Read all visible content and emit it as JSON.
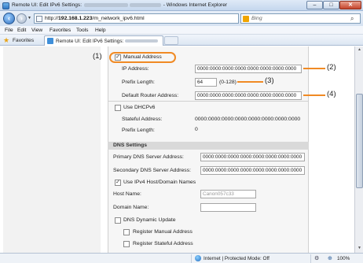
{
  "window": {
    "title_prefix": "Remote UI: Edit IPv6 Settings:",
    "title_suffix": "- Windows Internet Explorer",
    "minimize": "–",
    "maximize": "□",
    "close": "✕"
  },
  "navigation": {
    "url_prefix": "http://",
    "url_host": "192.168.1.223",
    "url_path": "/m_network_ipv6.html",
    "search_placeholder": "Bing",
    "back_icon": "back-arrow-icon",
    "forward_icon": "forward-arrow-icon"
  },
  "menu": {
    "items": [
      "File",
      "Edit",
      "View",
      "Favorites",
      "Tools",
      "Help"
    ]
  },
  "favorites": {
    "label": "Favorites",
    "tab_title": "Remote UI: Edit IPv6 Settings:"
  },
  "form": {
    "manual_address": {
      "label": "Manual Address",
      "checked": true
    },
    "ip_address": {
      "label": "IP Address:",
      "value": "0000:0000:0000:0000:0000:0000:0000:0000"
    },
    "prefix_length": {
      "label": "Prefix Length:",
      "value": "64",
      "hint": "(0-128)"
    },
    "default_router": {
      "label": "Default Router Address:",
      "value": "0000:0000:0000:0000:0000:0000:0000:0000"
    },
    "use_dhcpv6": {
      "label": "Use DHCPv6",
      "checked": false
    },
    "stateful_address": {
      "label": "Stateful Address:",
      "value": "0000:0000:0000:0000:0000:0000:0000:0000"
    },
    "stateful_prefix": {
      "label": "Prefix Length:",
      "value": "0"
    }
  },
  "dns": {
    "section_title": "DNS Settings",
    "primary": {
      "label": "Primary DNS Server Address:",
      "value": "0000:0000:0000:0000:0000:0000:0000:0000"
    },
    "secondary": {
      "label": "Secondary DNS Server Address:",
      "value": "0000:0000:0000:0000:0000:0000:0000:0000"
    },
    "use_ipv4_host": {
      "label": "Use IPv4 Host/Domain Names",
      "checked": true
    },
    "host_name": {
      "label": "Host Name:",
      "value": "Canon057c33"
    },
    "domain_name": {
      "label": "Domain Name:",
      "value": ""
    },
    "dns_dynamic_update": {
      "label": "DNS Dynamic Update",
      "checked": false
    },
    "register_manual": {
      "label": "Register Manual Address",
      "checked": false
    },
    "register_stateful": {
      "label": "Register Stateful Address",
      "checked": false
    }
  },
  "callouts": [
    "(1)",
    "(2)",
    "(3)",
    "(4)"
  ],
  "status": {
    "zone": "Internet | Protected Mode: Off",
    "zoom": "100%"
  },
  "colors": {
    "callout_orange": "#f08a24",
    "section_header": "#d9d9d9",
    "panel_bg": "#f6f6f6"
  }
}
